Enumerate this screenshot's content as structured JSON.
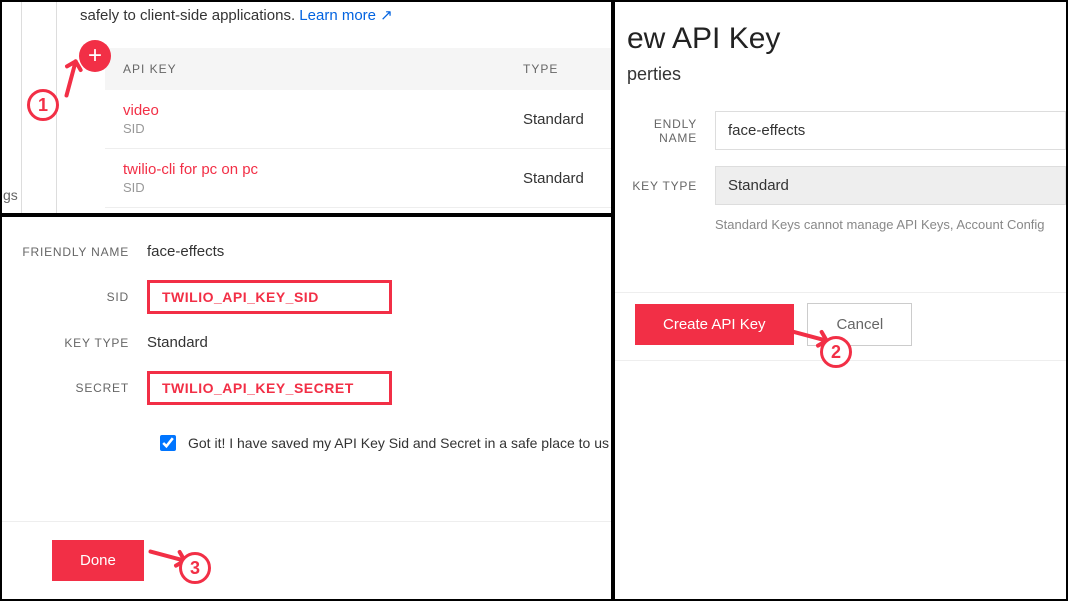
{
  "panel1": {
    "intro_suffix": "safely to client-side applications.",
    "learn_more": "Learn more ↗",
    "gs_text": "gs",
    "table": {
      "header_key": "API KEY",
      "header_type": "TYPE",
      "rows": [
        {
          "name": "video",
          "sid": "SID",
          "type": "Standard"
        },
        {
          "name": "twilio-cli for pc on pc",
          "sid": "SID",
          "type": "Standard"
        }
      ]
    }
  },
  "panel2": {
    "title": "ew API Key",
    "subtitle": "perties",
    "friendly_name_label": "ENDLY NAME",
    "friendly_name_value": "face-effects",
    "key_type_label": "KEY TYPE",
    "key_type_value": "Standard",
    "key_type_note": "Standard Keys cannot manage API Keys, Account Config",
    "create_btn": "Create API Key",
    "cancel_btn": "Cancel"
  },
  "panel3": {
    "friendly_name_label": "FRIENDLY NAME",
    "friendly_name_value": "face-effects",
    "sid_label": "SID",
    "sid_value": "TWILIO_API_KEY_SID",
    "key_type_label": "KEY TYPE",
    "key_type_value": "Standard",
    "secret_label": "SECRET",
    "secret_value": "TWILIO_API_KEY_SECRET",
    "checkbox_label": "Got it! I have saved my API Key Sid and Secret in a safe place to us",
    "done_btn": "Done"
  },
  "steps": {
    "one": "1",
    "two": "2",
    "three": "3"
  }
}
